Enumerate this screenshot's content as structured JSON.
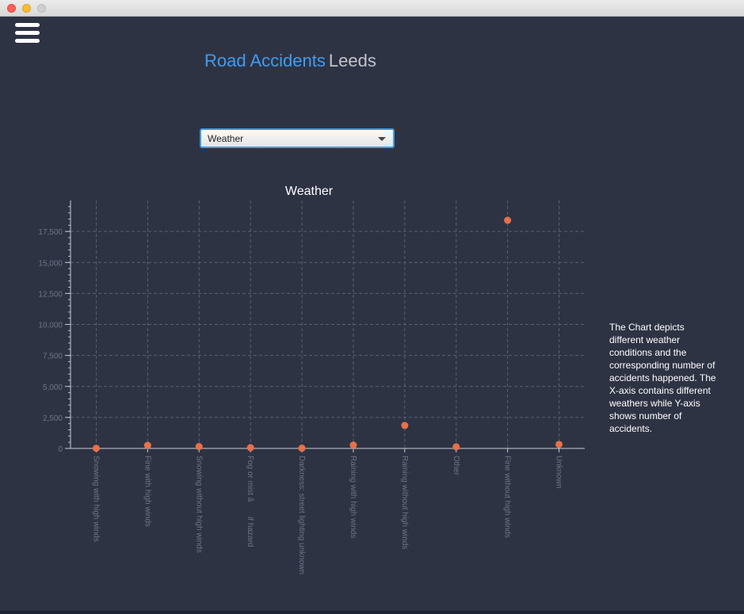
{
  "window": {
    "title": ""
  },
  "header": {
    "menu_icon": "hamburger-menu-icon",
    "title_primary": "Road Accidents",
    "title_secondary": "Leeds"
  },
  "selector": {
    "value": "Weather"
  },
  "description": "The Chart depicts different weather conditions and the corresponding number of accidents happened. The X-axis contains different weathers while Y-axis shows number of accidents.",
  "colors": {
    "accent": "#3f9cf0",
    "point": "#e8704a",
    "background": "#2e3344"
  },
  "chart_data": {
    "type": "scatter",
    "title": "Weather",
    "xlabel": "",
    "ylabel": "",
    "ylim": [
      0,
      20000
    ],
    "yticks": [
      0,
      2500,
      5000,
      7500,
      10000,
      12500,
      15000,
      17500
    ],
    "ytick_labels": [
      "0",
      "2,500",
      "5,000",
      "7,500",
      "10,000",
      "12,500",
      "15,000",
      "17,500"
    ],
    "grid": true,
    "legend": "none",
    "categories": [
      "Snowing with high winds",
      "Fine with high winds",
      "Snowing without high winds",
      "Fog or mist â if hazard",
      "Darkness: street lighting unknown",
      "Raining with high winds",
      "Raining without high winds",
      "Other",
      "Fine without high winds",
      "Unknown"
    ],
    "values": [
      10,
      250,
      150,
      60,
      20,
      270,
      1850,
      130,
      18400,
      320
    ]
  }
}
